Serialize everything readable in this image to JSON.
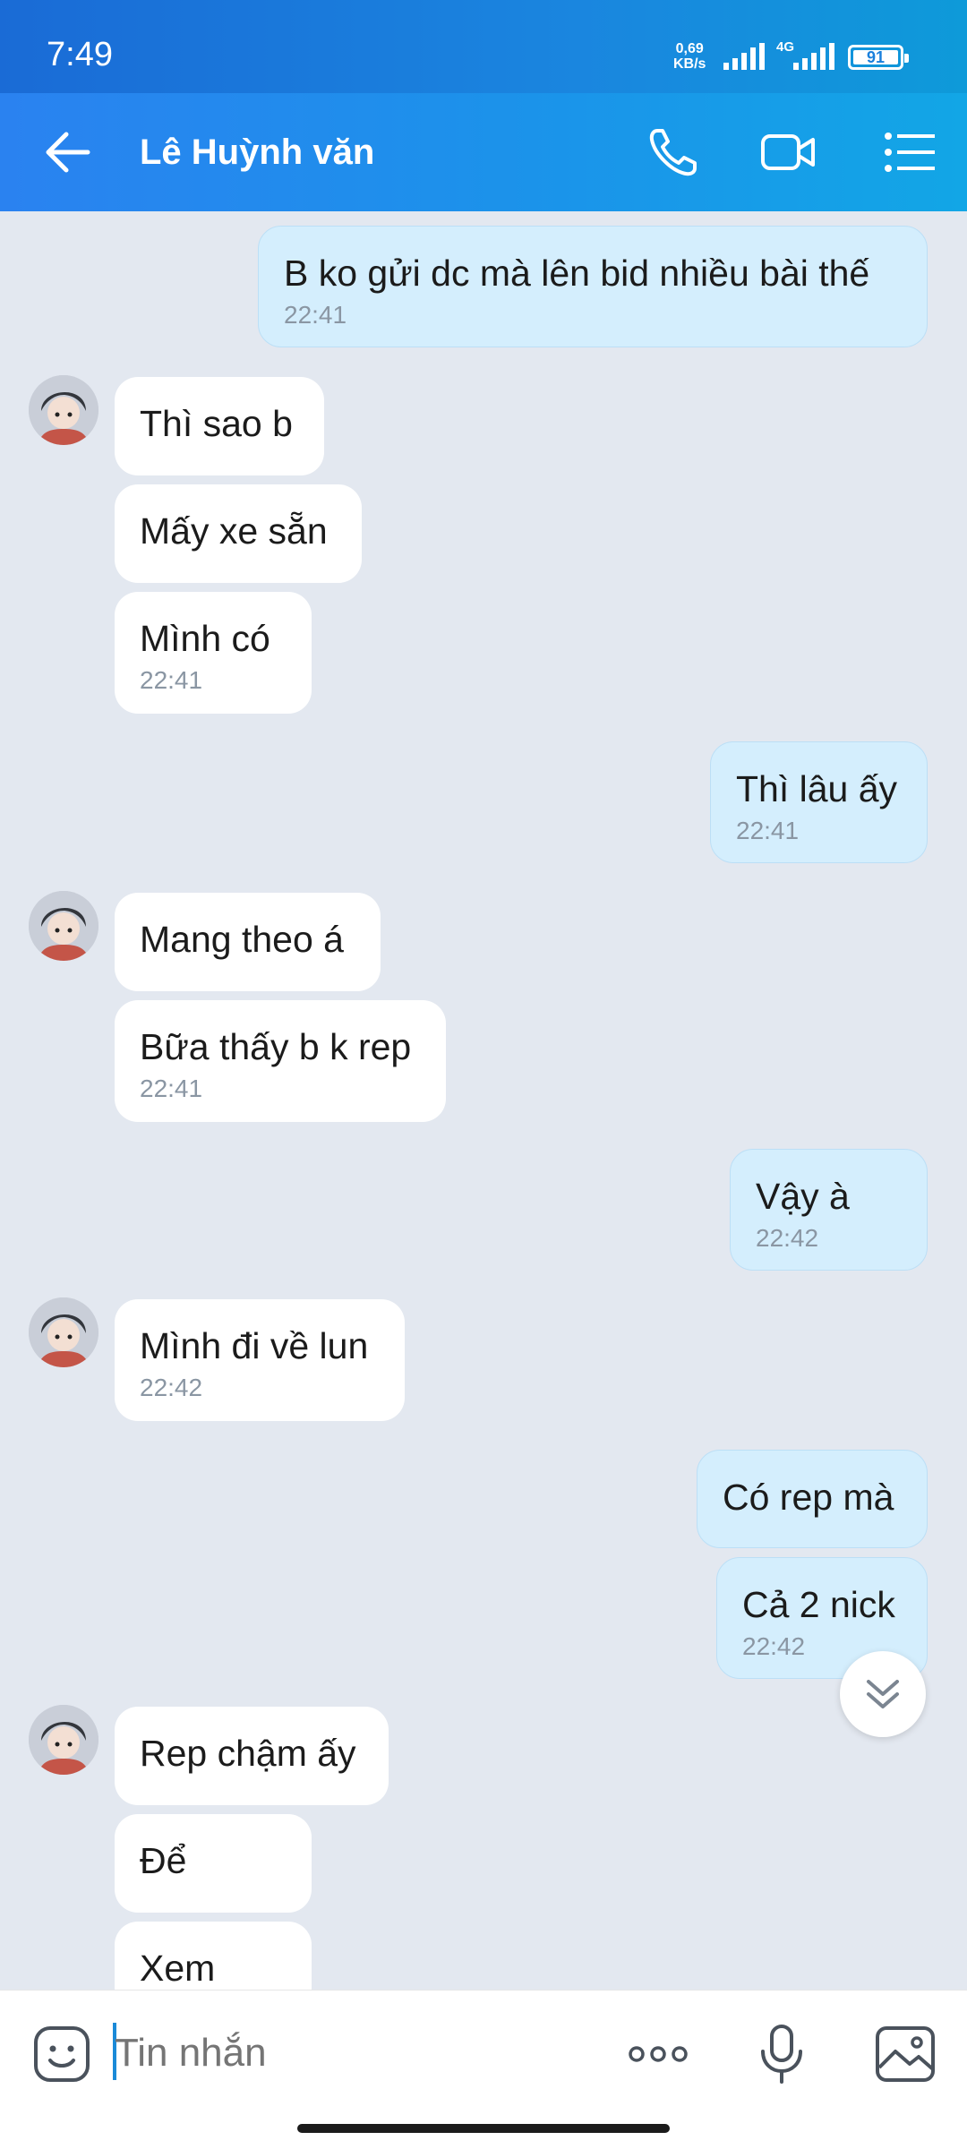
{
  "status_bar": {
    "time": "7:49",
    "net_speed_value": "0,69",
    "net_speed_unit": "KB/s",
    "network": "4G",
    "battery": "91"
  },
  "header": {
    "contact_name": "Lê Huỳnh văn",
    "icons": [
      "back-arrow-icon",
      "phone-icon",
      "video-call-icon",
      "menu-list-icon"
    ],
    "color_start": "#2a82f0",
    "color_end": "#12a6e6"
  },
  "messages": [
    {
      "dir": "out",
      "text": "B ko gửi dc mà lên bid nhiều bài thế",
      "time": "22:41"
    },
    {
      "dir": "in",
      "text": "Thì sao b"
    },
    {
      "dir": "in",
      "text": "Mấy xe sẵn"
    },
    {
      "dir": "in",
      "text": "Mình có",
      "time": "22:41"
    },
    {
      "dir": "out",
      "text": "Thì lâu ấy",
      "time": "22:41"
    },
    {
      "dir": "in",
      "text": "Mang theo á"
    },
    {
      "dir": "in",
      "text": "Bữa thấy b k rep",
      "time": "22:41"
    },
    {
      "dir": "out",
      "text": "Vậy à",
      "time": "22:42"
    },
    {
      "dir": "in",
      "text": "Mình đi về lun",
      "time": "22:42"
    },
    {
      "dir": "out",
      "text": "Có rep mà"
    },
    {
      "dir": "out",
      "text": "Cả 2 nick",
      "time": "22:42"
    },
    {
      "dir": "in",
      "text": "Rep chậm ấy"
    },
    {
      "dir": "in",
      "text": "Để"
    },
    {
      "dir": "in",
      "text": "Xem"
    }
  ],
  "composer": {
    "placeholder": "Tin nhắn",
    "icons": [
      "sticker-icon",
      "more-options-icon",
      "microphone-icon",
      "image-gallery-icon"
    ]
  },
  "colors": {
    "incoming_bubble": "#ffffff",
    "outgoing_bubble": "#d4eefd",
    "chat_background": "#e3e8f0"
  }
}
